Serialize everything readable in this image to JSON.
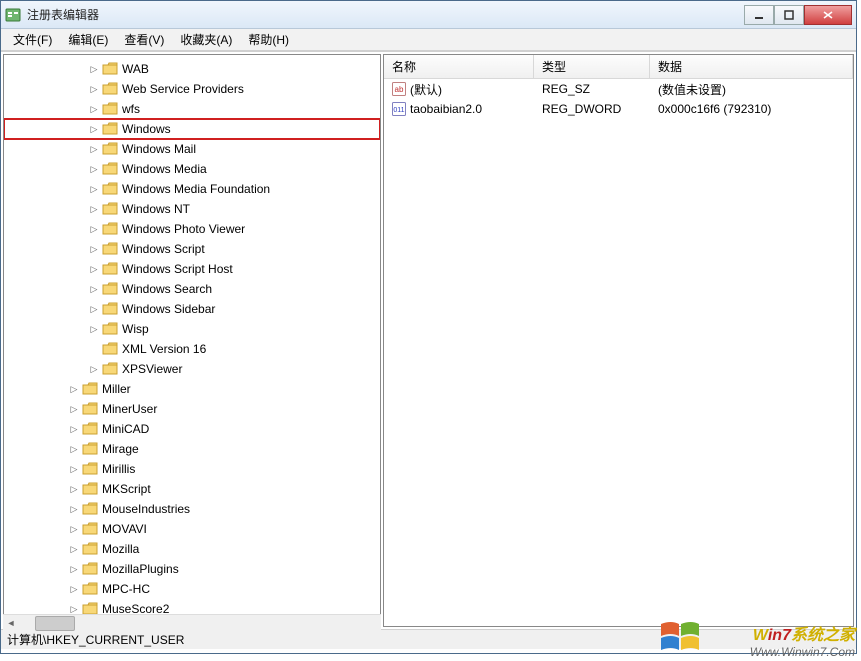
{
  "window": {
    "title": "注册表编辑器"
  },
  "menu": {
    "file": "文件(F)",
    "edit": "编辑(E)",
    "view": "查看(V)",
    "favorites": "收藏夹(A)",
    "help": "帮助(H)"
  },
  "tree": {
    "items": [
      {
        "indent": 4,
        "label": "WAB",
        "expandable": true
      },
      {
        "indent": 4,
        "label": "Web Service Providers",
        "expandable": true
      },
      {
        "indent": 4,
        "label": "wfs",
        "expandable": true
      },
      {
        "indent": 4,
        "label": "Windows",
        "expandable": true,
        "highlight": true
      },
      {
        "indent": 4,
        "label": "Windows Mail",
        "expandable": true
      },
      {
        "indent": 4,
        "label": "Windows Media",
        "expandable": true
      },
      {
        "indent": 4,
        "label": "Windows Media Foundation",
        "expandable": true
      },
      {
        "indent": 4,
        "label": "Windows NT",
        "expandable": true
      },
      {
        "indent": 4,
        "label": "Windows Photo Viewer",
        "expandable": true
      },
      {
        "indent": 4,
        "label": "Windows Script",
        "expandable": true
      },
      {
        "indent": 4,
        "label": "Windows Script Host",
        "expandable": true
      },
      {
        "indent": 4,
        "label": "Windows Search",
        "expandable": true
      },
      {
        "indent": 4,
        "label": "Windows Sidebar",
        "expandable": true
      },
      {
        "indent": 4,
        "label": "Wisp",
        "expandable": true
      },
      {
        "indent": 4,
        "label": "XML Version 16",
        "expandable": false
      },
      {
        "indent": 4,
        "label": "XPSViewer",
        "expandable": true
      },
      {
        "indent": 3,
        "label": "Miller",
        "expandable": true
      },
      {
        "indent": 3,
        "label": "MinerUser",
        "expandable": true
      },
      {
        "indent": 3,
        "label": "MiniCAD",
        "expandable": true
      },
      {
        "indent": 3,
        "label": "Mirage",
        "expandable": true
      },
      {
        "indent": 3,
        "label": "Mirillis",
        "expandable": true
      },
      {
        "indent": 3,
        "label": "MKScript",
        "expandable": true
      },
      {
        "indent": 3,
        "label": "MouseIndustries",
        "expandable": true
      },
      {
        "indent": 3,
        "label": "MOVAVI",
        "expandable": true
      },
      {
        "indent": 3,
        "label": "Mozilla",
        "expandable": true
      },
      {
        "indent": 3,
        "label": "MozillaPlugins",
        "expandable": true
      },
      {
        "indent": 3,
        "label": "MPC-HC",
        "expandable": true
      },
      {
        "indent": 3,
        "label": "MuseScore2",
        "expandable": true
      }
    ]
  },
  "list": {
    "header": {
      "name": "名称",
      "type": "类型",
      "data": "数据"
    },
    "rows": [
      {
        "icon": "string",
        "name": "(默认)",
        "type": "REG_SZ",
        "data": "(数值未设置)"
      },
      {
        "icon": "dword",
        "name": "taobaibian2.0",
        "type": "REG_DWORD",
        "data": "0x000c16f6 (792310)"
      }
    ]
  },
  "statusbar": {
    "path": "计算机\\HKEY_CURRENT_USER"
  },
  "watermark": {
    "brand_prefix": "W",
    "brand_accent": "in7",
    "brand_suffix": "系统之家",
    "url": "Www.Winwin7.Com"
  }
}
